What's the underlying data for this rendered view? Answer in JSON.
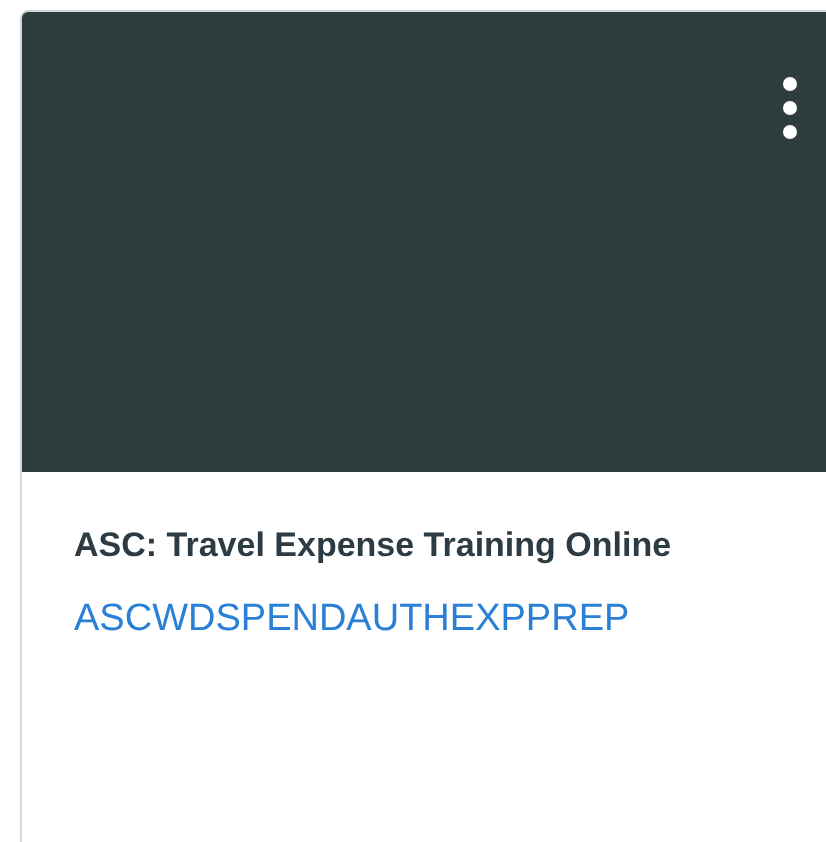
{
  "card": {
    "title": "ASC: Travel Expense Training Online",
    "code": "ASCWDSPENDAUTHEXPPREP"
  }
}
